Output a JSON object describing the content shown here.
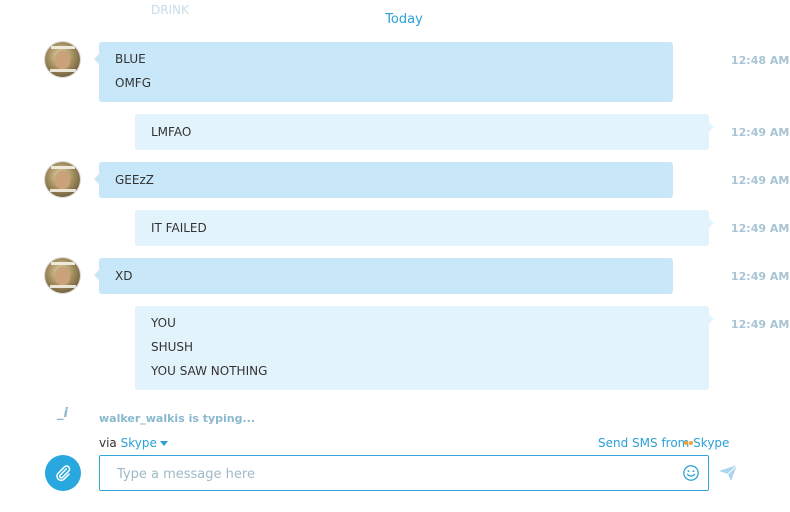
{
  "conversation": {
    "previous_message": "DRINK",
    "date_separator": "Today",
    "messages": [
      {
        "lines": [
          "BLUE",
          "OMFG"
        ],
        "time": "12:48 AM"
      },
      {
        "lines": [
          "LMFAO"
        ],
        "time": "12:49 AM"
      },
      {
        "lines": [
          "GEEzZ"
        ],
        "time": "12:49 AM"
      },
      {
        "lines": [
          "IT FAILED"
        ],
        "time": "12:49 AM"
      },
      {
        "lines": [
          "XD"
        ],
        "time": "12:49 AM"
      },
      {
        "lines": [
          "YOU",
          "SHUSH",
          "YOU SAW NOTHING"
        ],
        "time": "12:49 AM"
      }
    ]
  },
  "typing": {
    "icon_glyph": "_i",
    "text": "walker_walkis is typing..."
  },
  "compose_bar": {
    "via_prefix": "via",
    "via_service": "Skype",
    "sms_link": "Send SMS from Skype",
    "placeholder": "Type a message here"
  },
  "icons": {
    "attach": "paperclip-icon",
    "emoji": "smiley-icon",
    "send": "paper-plane-icon",
    "typing": "pencil-typing-icon"
  },
  "colors": {
    "accent": "#29a8e0",
    "incoming_bubble": "#c8e8f9",
    "outgoing_bubble": "#e3f3fc",
    "timestamp": "#a8c4d3"
  }
}
